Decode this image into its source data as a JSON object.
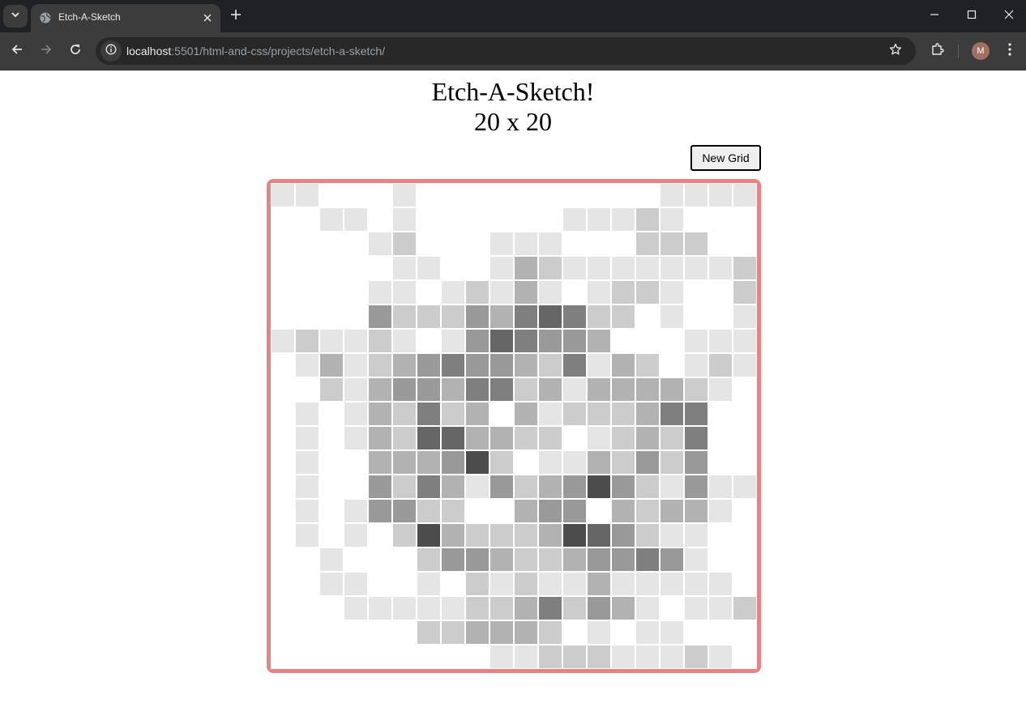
{
  "browser": {
    "tab_title": "Etch-A-Sketch",
    "url_host": "localhost",
    "url_rest": ":5501/html-and-css/projects/etch-a-sketch/",
    "profile_initial": "M",
    "icons": [
      "tab-list-icon",
      "globe-icon",
      "close-icon",
      "plus-icon",
      "minimize-icon",
      "maximize-icon",
      "close-window-icon",
      "back-arrow-icon",
      "forward-arrow-icon",
      "reload-icon",
      "site-info-icon",
      "star-icon",
      "extensions-icon",
      "more-vert-icon"
    ]
  },
  "page": {
    "title": "Etch-A-Sketch!",
    "grid_size_label": "20 x 20",
    "new_grid_button": "New Grid",
    "board_border_color": "#e98282"
  },
  "grid": {
    "rows": 20,
    "cols": 20,
    "shade_scale": {
      "0": "#ffffff",
      "1": "#e5e5e5",
      "2": "#cccccc",
      "3": "#b2b2b2",
      "4": "#999999",
      "5": "#7f7f7f",
      "6": "#666666",
      "7": "#4c4c4c"
    },
    "cells": [
      [
        1,
        1,
        0,
        0,
        0,
        1,
        0,
        0,
        0,
        0,
        0,
        0,
        0,
        0,
        0,
        0,
        1,
        1,
        1,
        1
      ],
      [
        0,
        0,
        1,
        1,
        0,
        1,
        0,
        0,
        0,
        0,
        0,
        0,
        1,
        1,
        1,
        2,
        1,
        0,
        0,
        0
      ],
      [
        0,
        0,
        0,
        0,
        1,
        2,
        0,
        0,
        0,
        1,
        1,
        1,
        0,
        0,
        0,
        2,
        2,
        2,
        0,
        0
      ],
      [
        0,
        0,
        0,
        0,
        0,
        1,
        1,
        0,
        0,
        1,
        3,
        2,
        1,
        1,
        1,
        1,
        1,
        1,
        1,
        2
      ],
      [
        0,
        0,
        0,
        0,
        1,
        1,
        0,
        1,
        2,
        1,
        3,
        1,
        0,
        1,
        2,
        2,
        1,
        0,
        0,
        2
      ],
      [
        0,
        0,
        0,
        0,
        4,
        2,
        2,
        2,
        4,
        3,
        5,
        6,
        5,
        2,
        2,
        0,
        1,
        0,
        0,
        1
      ],
      [
        1,
        2,
        1,
        1,
        2,
        1,
        0,
        1,
        4,
        6,
        5,
        4,
        4,
        3,
        0,
        0,
        0,
        1,
        1,
        1
      ],
      [
        0,
        1,
        3,
        1,
        2,
        3,
        4,
        5,
        4,
        4,
        3,
        2,
        5,
        1,
        3,
        2,
        0,
        1,
        2,
        1
      ],
      [
        0,
        0,
        2,
        1,
        3,
        4,
        4,
        3,
        5,
        5,
        2,
        3,
        1,
        3,
        3,
        3,
        3,
        2,
        1,
        0
      ],
      [
        0,
        1,
        0,
        1,
        3,
        2,
        5,
        2,
        3,
        0,
        3,
        1,
        2,
        2,
        2,
        3,
        5,
        5,
        0,
        0
      ],
      [
        0,
        1,
        0,
        1,
        3,
        2,
        6,
        6,
        3,
        3,
        2,
        2,
        0,
        1,
        2,
        3,
        2,
        5,
        0,
        0
      ],
      [
        0,
        1,
        0,
        0,
        3,
        3,
        3,
        4,
        7,
        2,
        0,
        1,
        1,
        3,
        2,
        4,
        2,
        4,
        0,
        0
      ],
      [
        0,
        1,
        0,
        0,
        4,
        2,
        5,
        3,
        1,
        4,
        2,
        3,
        4,
        7,
        4,
        2,
        1,
        4,
        1,
        1
      ],
      [
        0,
        1,
        0,
        1,
        4,
        4,
        2,
        2,
        0,
        0,
        3,
        4,
        4,
        0,
        3,
        2,
        3,
        3,
        1,
        0
      ],
      [
        0,
        1,
        0,
        1,
        0,
        2,
        7,
        3,
        2,
        2,
        2,
        3,
        7,
        6,
        4,
        2,
        1,
        1,
        0,
        0
      ],
      [
        0,
        0,
        1,
        0,
        0,
        0,
        2,
        4,
        4,
        3,
        2,
        2,
        3,
        4,
        4,
        5,
        4,
        1,
        0,
        0
      ],
      [
        0,
        0,
        1,
        1,
        0,
        0,
        1,
        0,
        2,
        1,
        2,
        1,
        1,
        3,
        1,
        1,
        1,
        1,
        1,
        0
      ],
      [
        0,
        0,
        0,
        1,
        1,
        1,
        1,
        1,
        2,
        2,
        3,
        5,
        2,
        4,
        3,
        1,
        0,
        1,
        1,
        2
      ],
      [
        0,
        0,
        0,
        0,
        0,
        0,
        2,
        2,
        3,
        3,
        3,
        2,
        0,
        1,
        0,
        1,
        1,
        0,
        0,
        0
      ],
      [
        0,
        0,
        0,
        0,
        0,
        0,
        0,
        0,
        0,
        1,
        1,
        2,
        2,
        2,
        1,
        1,
        1,
        2,
        1,
        0
      ]
    ]
  }
}
